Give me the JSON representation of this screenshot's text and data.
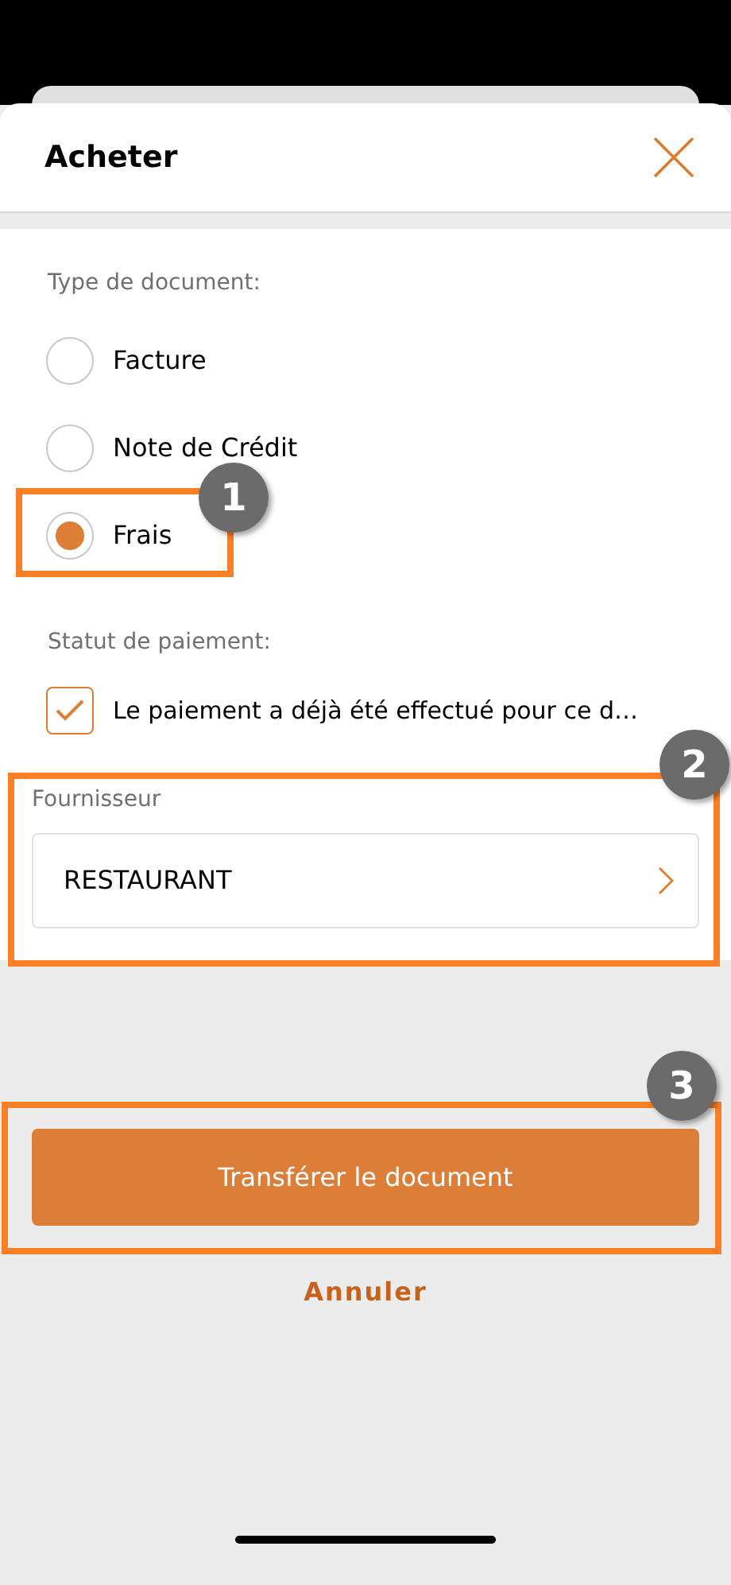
{
  "dialog": {
    "title": "Acheter"
  },
  "document_type": {
    "label": "Type de document:",
    "options": [
      {
        "label": "Facture",
        "selected": false
      },
      {
        "label": "Note de Crédit",
        "selected": false
      },
      {
        "label": "Frais",
        "selected": true
      }
    ]
  },
  "payment_status": {
    "label": "Statut de paiement:",
    "checkbox": {
      "label": "Le paiement a déjà été effectué pour ce d…",
      "checked": true
    }
  },
  "supplier": {
    "label": "Fournisseur",
    "value": "RESTAURANT"
  },
  "primary_button": "Transférer le document",
  "cancel_link": "Annuler",
  "callouts": [
    {
      "number": "1"
    },
    {
      "number": "2"
    },
    {
      "number": "3"
    }
  ]
}
